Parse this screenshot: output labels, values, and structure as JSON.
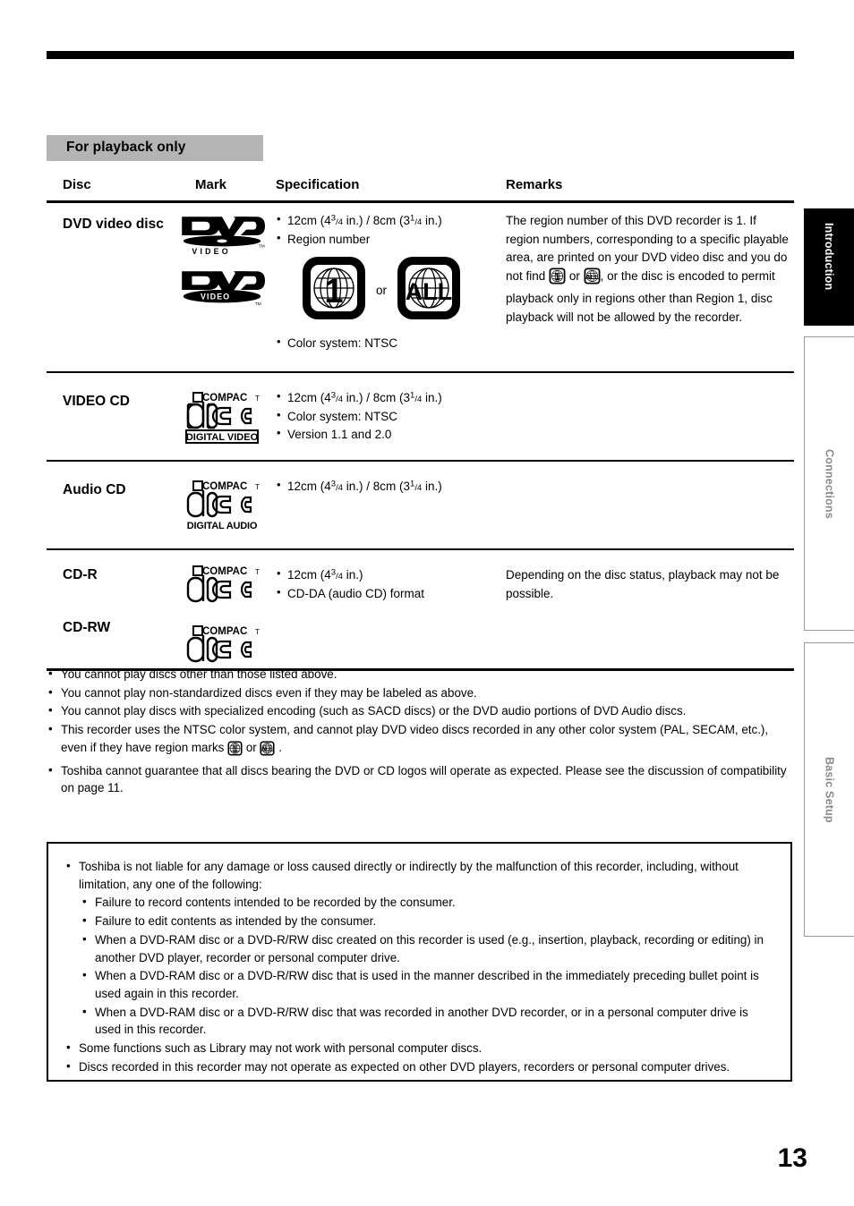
{
  "page": {
    "number": "13",
    "section_banner": "For playback only"
  },
  "table": {
    "headers": {
      "disc": "Disc",
      "mark": "Mark",
      "specification": "Specification",
      "remarks": "Remarks"
    },
    "rows": [
      {
        "disc": "DVD video disc",
        "mark_logos": [
          "dvd-video-logo",
          "dvd-video-logo-alt"
        ],
        "spec": [
          "12cm (4 3/4 in.) / 8cm (3 1/4 in.)",
          "Region number",
          "Color system: NTSC"
        ],
        "spec_line1_prefix": "12cm (4",
        "spec_line1_mid": " in.) / 8cm (3",
        "spec_line1_suffix": " in.)",
        "spec_line2": "Region number",
        "spec_line3": "Color system: NTSC",
        "region_or": "or",
        "region_mark_1": "1",
        "region_mark_all": "ALL",
        "remarks": "The region number of this DVD recorder is 1. If region numbers, corresponding to a specific playable area, are printed on your DVD video disc and you do not find [region-1-icon] or [region-all-icon] , or the disc is encoded to permit playback only in regions other than Region 1, disc playback will not be allowed by the recorder.",
        "remarks_part1": "The region number of this DVD recorder is 1. If region numbers, corresponding to a specific playable area, are printed on your DVD video disc and you do not find",
        "remarks_or": "or",
        "remarks_part2": ", or the disc is encoded to permit playback only in regions other than Region 1, disc playback will not be allowed by the recorder."
      },
      {
        "disc": "VIDEO CD",
        "mark_logos": [
          "compact-disc-digital-video-logo"
        ],
        "mark_logo_top": "COMPACT",
        "mark_logo_mid": "disc",
        "mark_logo_bottom": "DIGITAL VIDEO",
        "spec_line1_prefix": "12cm (4",
        "spec_line1_mid": " in.) / 8cm (3",
        "spec_line1_suffix": " in.)",
        "spec_line2": "Color system: NTSC",
        "spec_line3": "Version 1.1 and 2.0",
        "remarks": ""
      },
      {
        "disc": "Audio CD",
        "mark_logos": [
          "compact-disc-digital-audio-logo"
        ],
        "mark_logo_top": "COMPACT",
        "mark_logo_mid": "disc",
        "mark_logo_bottom": "DIGITAL AUDIO",
        "spec_line1_prefix": "12cm (4",
        "spec_line1_mid": " in.) / 8cm (3",
        "spec_line1_suffix": " in.)",
        "remarks": ""
      },
      {
        "disc": "CD-R",
        "disc2": "CD-RW",
        "mark_logos": [
          "compact-disc-logo",
          "compact-disc-logo"
        ],
        "mark_logo_top": "COMPACT",
        "mark_logo_mid": "disc",
        "spec_line1_prefix": "12cm (4",
        "spec_line1_suffix": " in.)",
        "spec_line2": "CD-DA (audio CD) format",
        "remarks": "Depending on the disc status, playback may not be possible."
      }
    ]
  },
  "notes": [
    "You cannot play discs other than those listed above.",
    "You cannot play non-standardized discs even if they may be labeled as above.",
    "You cannot play discs with specialized encoding (such as SACD discs) or the DVD audio portions of DVD Audio discs.",
    "This recorder uses the NTSC color system, and cannot play DVD video discs recorded in any other color system (PAL, SECAM, etc.), even if they have region marks",
    "Toshiba cannot guarantee that all discs bearing the DVD or CD logos will operate as expected.  Please see the discussion of compatibility on page 11."
  ],
  "notes_inline": {
    "note4_or": "or",
    "note4_end": "."
  },
  "disclaimer": [
    {
      "level": 1,
      "text": "Toshiba is not liable for any damage or loss caused directly or indirectly by the malfunction of this recorder, including, without limitation, any one of the following:"
    },
    {
      "level": 2,
      "text": "Failure to record contents intended to be recorded by the consumer."
    },
    {
      "level": 2,
      "text": "Failure to edit contents as intended by the consumer."
    },
    {
      "level": 2,
      "text": "When a DVD-RAM disc or a DVD-R/RW disc created on this recorder is used (e.g., insertion, playback, recording or editing) in another DVD player, recorder or personal computer drive."
    },
    {
      "level": 2,
      "text": "When a DVD-RAM disc or a DVD-R/RW disc that is used in the manner described in the immediately preceding bullet point is used again in this recorder."
    },
    {
      "level": 2,
      "text": "When a DVD-RAM disc or a DVD-R/RW disc that was recorded in another DVD recorder, or in a personal computer drive is used in this recorder."
    },
    {
      "level": 1,
      "text": "Some functions such as Library may not work with personal computer discs."
    },
    {
      "level": 1,
      "text": "Discs recorded in this recorder may not operate as expected on other DVD players, recorders or personal computer drives."
    }
  ],
  "side_tabs": [
    {
      "label": "Introduction",
      "active": true
    },
    {
      "label": "Connections",
      "active": false
    },
    {
      "label": "Basic Setup",
      "active": false
    }
  ],
  "colors": {
    "banner_gray": "#b4b4b4",
    "tab_active_bg": "#000000",
    "tab_inactive_text": "#8a8a8a",
    "rule": "#000000"
  },
  "logos": {
    "dvd_text": "DVD",
    "dvd_video_text": "VIDEO",
    "dvd_tm": "TM",
    "compact_text": "COMPACT",
    "disc_text": "disc",
    "digital_video_text": "DIGITAL VIDEO",
    "digital_audio_text": "DIGITAL AUDIO"
  }
}
